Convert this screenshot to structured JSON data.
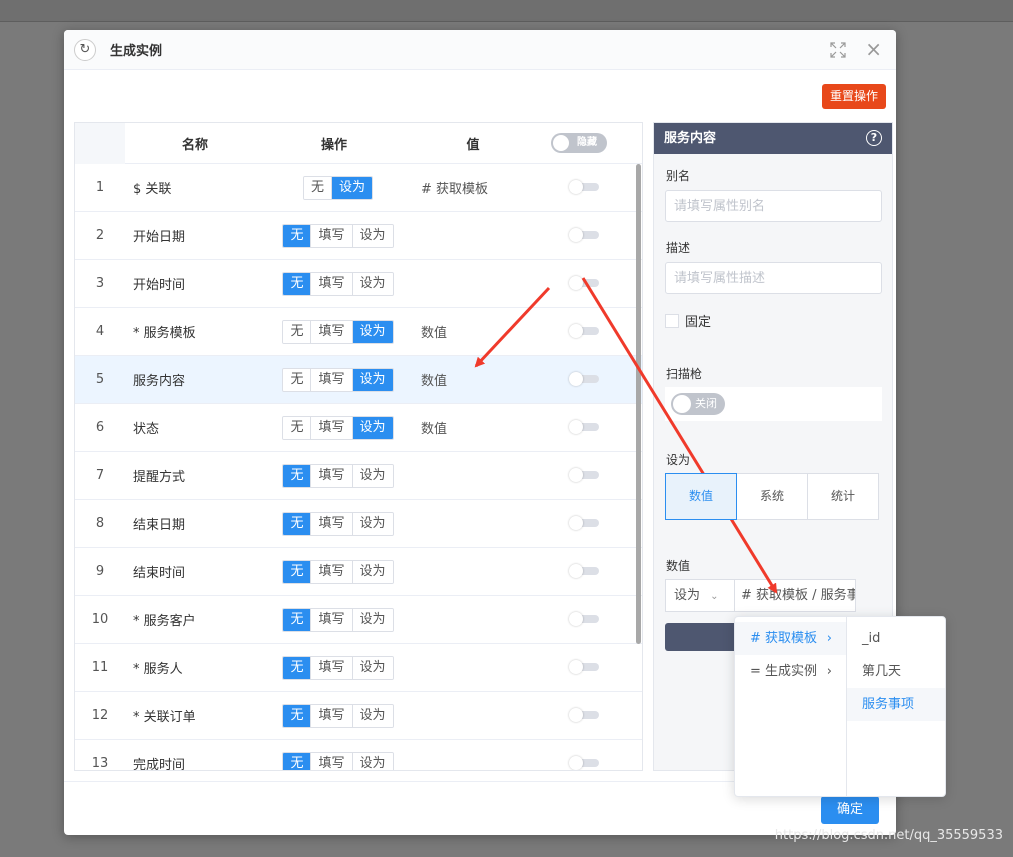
{
  "dialog": {
    "title": "生成实例",
    "reset_label": "重置操作",
    "ok_label": "确定"
  },
  "table": {
    "headers": {
      "name": "名称",
      "op": "操作",
      "value": "值",
      "hide": "隐藏"
    },
    "rows": [
      {
        "idx": "1",
        "name": "$ 关联",
        "ops": [
          "无",
          "设为"
        ],
        "on": 1,
        "value": "# 获取模板"
      },
      {
        "idx": "2",
        "name": "开始日期",
        "ops": [
          "无",
          "填写",
          "设为"
        ],
        "on": 0,
        "value": ""
      },
      {
        "idx": "3",
        "name": "开始时间",
        "ops": [
          "无",
          "填写",
          "设为"
        ],
        "on": 0,
        "value": ""
      },
      {
        "idx": "4",
        "name": "* 服务模板",
        "ops": [
          "无",
          "填写",
          "设为"
        ],
        "on": 2,
        "value": "数值"
      },
      {
        "idx": "5",
        "name": "服务内容",
        "ops": [
          "无",
          "填写",
          "设为"
        ],
        "on": 2,
        "value": "数值"
      },
      {
        "idx": "6",
        "name": "状态",
        "ops": [
          "无",
          "填写",
          "设为"
        ],
        "on": 2,
        "value": "数值"
      },
      {
        "idx": "7",
        "name": "提醒方式",
        "ops": [
          "无",
          "填写",
          "设为"
        ],
        "on": 0,
        "value": ""
      },
      {
        "idx": "8",
        "name": "结束日期",
        "ops": [
          "无",
          "填写",
          "设为"
        ],
        "on": 0,
        "value": ""
      },
      {
        "idx": "9",
        "name": "结束时间",
        "ops": [
          "无",
          "填写",
          "设为"
        ],
        "on": 0,
        "value": ""
      },
      {
        "idx": "10",
        "name": "* 服务客户",
        "ops": [
          "无",
          "填写",
          "设为"
        ],
        "on": 0,
        "value": ""
      },
      {
        "idx": "11",
        "name": "* 服务人",
        "ops": [
          "无",
          "填写",
          "设为"
        ],
        "on": 0,
        "value": ""
      },
      {
        "idx": "12",
        "name": "* 关联订单",
        "ops": [
          "无",
          "填写",
          "设为"
        ],
        "on": 0,
        "value": ""
      },
      {
        "idx": "13",
        "name": "完成时间",
        "ops": [
          "无",
          "填写",
          "设为"
        ],
        "on": 0,
        "value": ""
      }
    ]
  },
  "panel": {
    "title": "服务内容",
    "alias_label": "别名",
    "alias_placeholder": "请填写属性别名",
    "desc_label": "描述",
    "desc_placeholder": "请填写属性描述",
    "fixed_label": "固定",
    "scanner_label": "扫描枪",
    "scanner_toggle": "关闭",
    "set_label": "设为",
    "set_options": [
      "数值",
      "系统",
      "统计"
    ],
    "set_selected": 0,
    "value_label": "数值",
    "value_mode": "设为",
    "value_path": "# 获取模板 / 服务事项"
  },
  "cascader": {
    "col1": [
      "# 获取模板",
      "= 生成实例"
    ],
    "col2": [
      "_id",
      "第几天",
      "服务事项"
    ],
    "col1_active": 0,
    "col2_selected": 2
  },
  "watermark": "https://blog.csdn.net/qq_35559533",
  "colors": {
    "primary": "#2b8ef0",
    "reset": "#e8481a",
    "panel_head": "#4e5770",
    "annotation": "#f03a2b"
  }
}
